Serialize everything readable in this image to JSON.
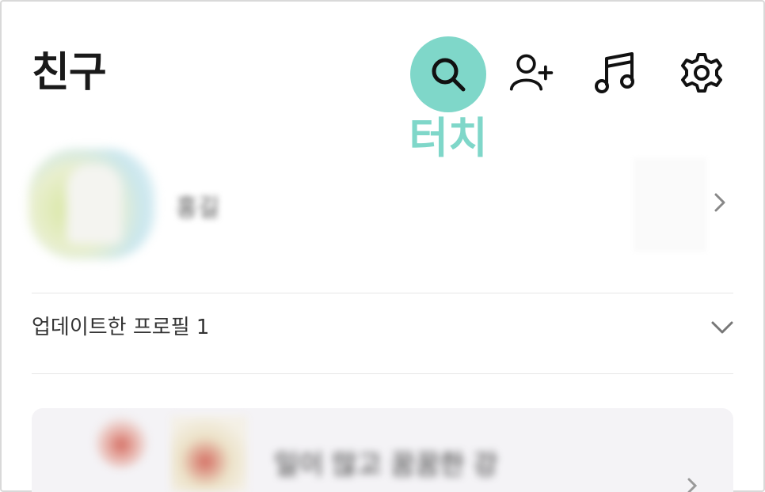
{
  "header": {
    "title": "친구",
    "icons": [
      "search-icon",
      "add-friend-icon",
      "music-icon",
      "settings-icon"
    ],
    "highlight_color": "#7fd7c9",
    "touch_label": "터치"
  },
  "my_profile": {
    "name": "홍길",
    "name_blurred": true
  },
  "updated_profiles": {
    "label": "업데이트한 프로필 1"
  },
  "friend_card": {
    "text": "일이 많고 꿈꿈한 강",
    "text_blurred": true
  }
}
